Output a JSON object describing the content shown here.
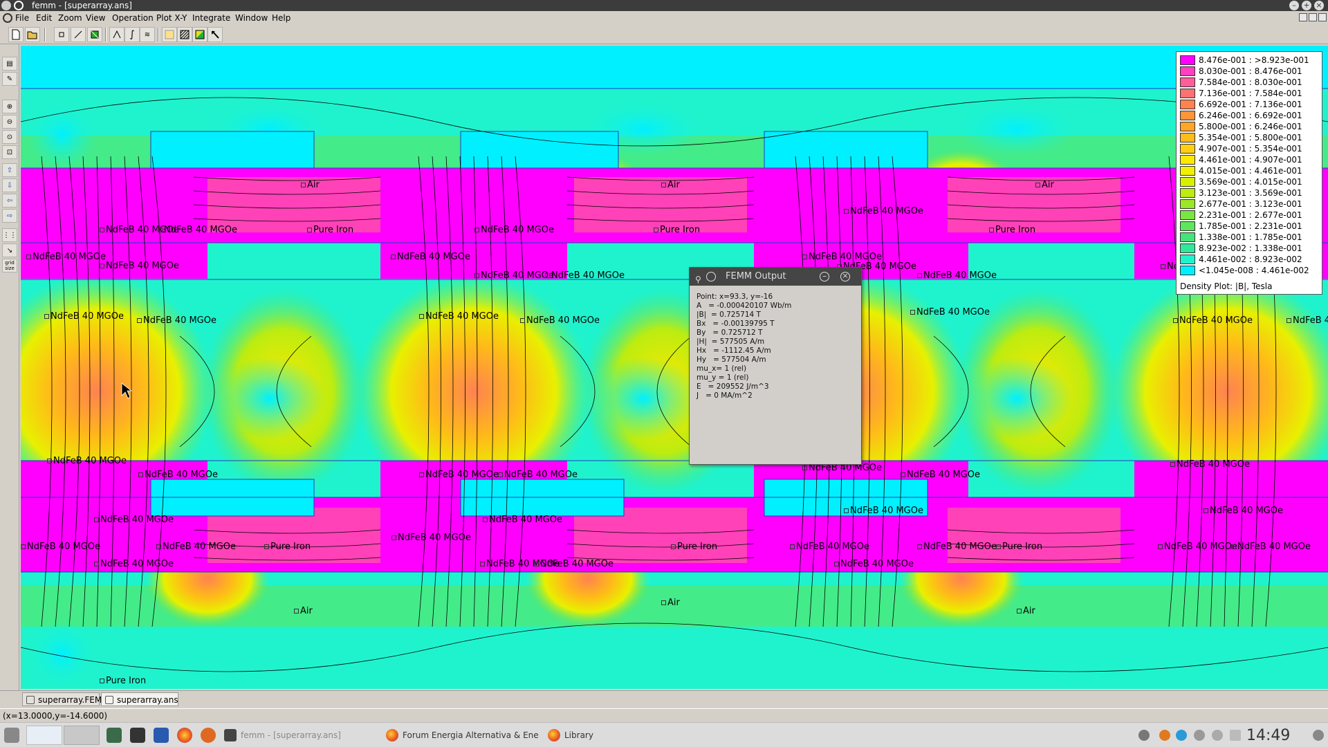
{
  "window": {
    "title": "femm - [superarray.ans]",
    "menus": [
      "File",
      "Edit",
      "Zoom",
      "View",
      "Operation",
      "Plot X-Y",
      "Integrate",
      "Window",
      "Help"
    ]
  },
  "toolbar": {
    "icons": [
      "new-file-icon",
      "open-file-icon",
      "node-mode-icon",
      "segment-mode-icon",
      "block-mode-icon",
      "line-integral-icon",
      "contour-icon",
      "contour-plot-icon",
      "vector-plot-icon",
      "density-plot-icon",
      "color-density-icon",
      "pointer-icon"
    ]
  },
  "left_toolbar": {
    "icons": [
      "view-results-icon",
      "edit-props-icon",
      "zoom-in-icon",
      "zoom-out-icon",
      "zoom-natural-icon",
      "zoom-window-icon",
      "pan-up-icon",
      "pan-down-icon",
      "pan-left-icon",
      "pan-right-icon",
      "grid-show-icon",
      "snap-grid-icon",
      "grid-size-icon"
    ],
    "grid_size_label": "grid size"
  },
  "plot": {
    "labels": {
      "air_top": [
        "Air",
        "Air",
        "Air"
      ],
      "air_bottom": [
        "Air",
        "Air",
        "Air"
      ],
      "pure_iron": "Pure Iron",
      "ndfeb": "NdFeB 40 MGOe",
      "ndfeb_partial": "Nc",
      "ndfeb_cut": "NdFeB 40"
    }
  },
  "legend": {
    "rows": [
      {
        "range": "8.476e-001 : >8.923e-001",
        "color": "#ff00ff"
      },
      {
        "range": "8.030e-001 : 8.476e-001",
        "color": "#ff40c0"
      },
      {
        "range": "7.584e-001 : 8.030e-001",
        "color": "#ff5e9a"
      },
      {
        "range": "7.136e-001 : 7.584e-001",
        "color": "#ff7070"
      },
      {
        "range": "6.692e-001 : 7.136e-001",
        "color": "#ff8250"
      },
      {
        "range": "6.246e-001 : 6.692e-001",
        "color": "#ff9438"
      },
      {
        "range": "5.800e-001 : 6.246e-001",
        "color": "#ffa626"
      },
      {
        "range": "5.354e-001 : 5.800e-001",
        "color": "#ffbb18"
      },
      {
        "range": "4.907e-001 : 5.354e-001",
        "color": "#ffd010"
      },
      {
        "range": "4.461e-001 : 4.907e-001",
        "color": "#ffe800"
      },
      {
        "range": "4.015e-001 : 4.461e-001",
        "color": "#f0f000"
      },
      {
        "range": "3.569e-001 : 4.015e-001",
        "color": "#d8f000"
      },
      {
        "range": "3.123e-001 : 3.569e-001",
        "color": "#bcec10"
      },
      {
        "range": "2.677e-001 : 3.123e-001",
        "color": "#9ae828"
      },
      {
        "range": "2.231e-001 : 2.677e-001",
        "color": "#7ae640"
      },
      {
        "range": "1.785e-001 : 2.231e-001",
        "color": "#5ee65c"
      },
      {
        "range": "1.338e-001 : 1.785e-001",
        "color": "#44e47a"
      },
      {
        "range": "8.923e-002 : 1.338e-001",
        "color": "#30e89a"
      },
      {
        "range": "4.461e-002 : 8.923e-002",
        "color": "#1ff3ce"
      },
      {
        "range": "<1.045e-008 : 4.461e-002",
        "color": "#00f0ff"
      }
    ],
    "caption": "Density Plot: |B|, Tesla"
  },
  "output_dialog": {
    "title": "FEMM Output",
    "lines": [
      "Point: x=93.3, y=-16",
      "A   = -0.000420107 Wb/m",
      "|B|  = 0.725714 T",
      "Bx   = -0.00139795 T",
      "By   = 0.725712 T",
      "|H|  = 577505 A/m",
      "Hx   = -1112.45 A/m",
      "Hy   = 577504 A/m",
      "mu_x= 1 (rel)",
      "mu_y = 1 (rel)",
      "E   = 209552 J/m^3",
      "J   = 0 MA/m^2"
    ]
  },
  "tabs": [
    "superarray.FEM",
    "superarray.ans"
  ],
  "status": "(x=13.0000,y=-14.6000)",
  "taskbar": {
    "tasks": [
      "femm - [superarray.ans]",
      "Forum Energia Alternativa & Ene",
      "Library"
    ],
    "clock": "14:49"
  }
}
